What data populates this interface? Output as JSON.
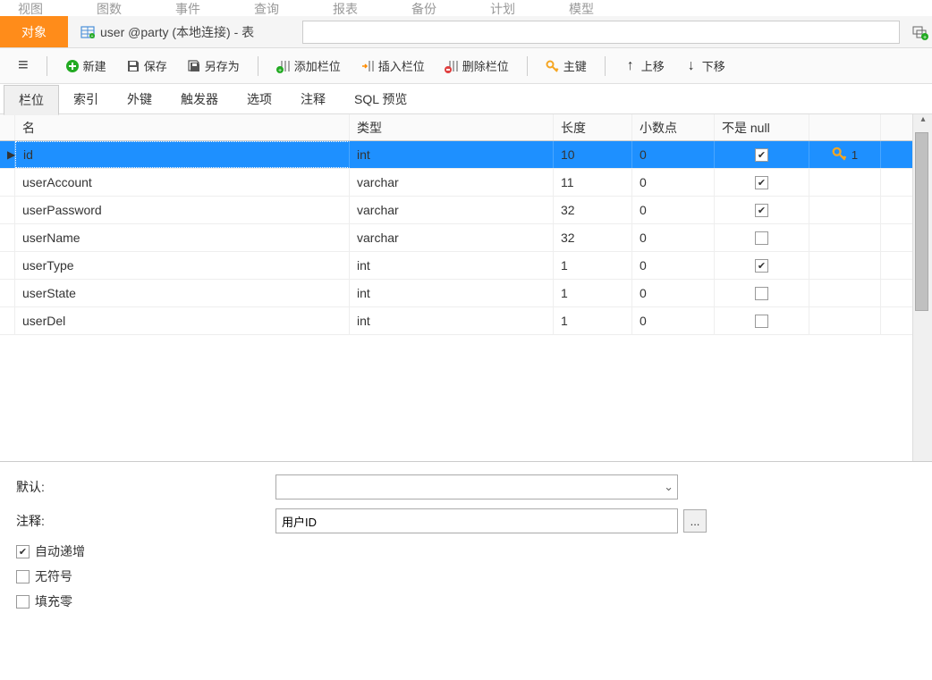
{
  "topMenu": [
    "视图",
    "图数",
    "事件",
    "查询",
    "报表",
    "备份",
    "计划",
    "模型"
  ],
  "tabs": {
    "object": "对象",
    "userTab": "user @party (本地连接) - 表"
  },
  "toolbar": {
    "new": "新建",
    "save": "保存",
    "saveAs": "另存为",
    "addField": "添加栏位",
    "insertField": "插入栏位",
    "deleteField": "删除栏位",
    "primaryKey": "主键",
    "moveUp": "上移",
    "moveDown": "下移"
  },
  "subTabs": {
    "fields": "栏位",
    "indexes": "索引",
    "foreignKeys": "外键",
    "triggers": "触发器",
    "options": "选项",
    "comments": "注释",
    "sqlPreview": "SQL 预览"
  },
  "columns": {
    "name": "名",
    "type": "类型",
    "length": "长度",
    "decimal": "小数点",
    "notNull": "不是 null"
  },
  "fields": [
    {
      "name": "id",
      "type": "int",
      "length": "10",
      "decimal": "0",
      "notNull": true,
      "pk": true,
      "keyIndex": "1",
      "selected": true
    },
    {
      "name": "userAccount",
      "type": "varchar",
      "length": "11",
      "decimal": "0",
      "notNull": true,
      "pk": false
    },
    {
      "name": "userPassword",
      "type": "varchar",
      "length": "32",
      "decimal": "0",
      "notNull": true,
      "pk": false
    },
    {
      "name": "userName",
      "type": "varchar",
      "length": "32",
      "decimal": "0",
      "notNull": false,
      "pk": false
    },
    {
      "name": "userType",
      "type": "int",
      "length": "1",
      "decimal": "0",
      "notNull": true,
      "pk": false
    },
    {
      "name": "userState",
      "type": "int",
      "length": "1",
      "decimal": "0",
      "notNull": false,
      "pk": false
    },
    {
      "name": "userDel",
      "type": "int",
      "length": "1",
      "decimal": "0",
      "notNull": false,
      "pk": false
    }
  ],
  "props": {
    "defaultLabel": "默认:",
    "defaultValue": "",
    "commentLabel": "注释:",
    "commentValue": "用户ID",
    "autoIncrement": "自动递增",
    "unsigned": "无符号",
    "zerofill": "填充零",
    "more": "..."
  }
}
